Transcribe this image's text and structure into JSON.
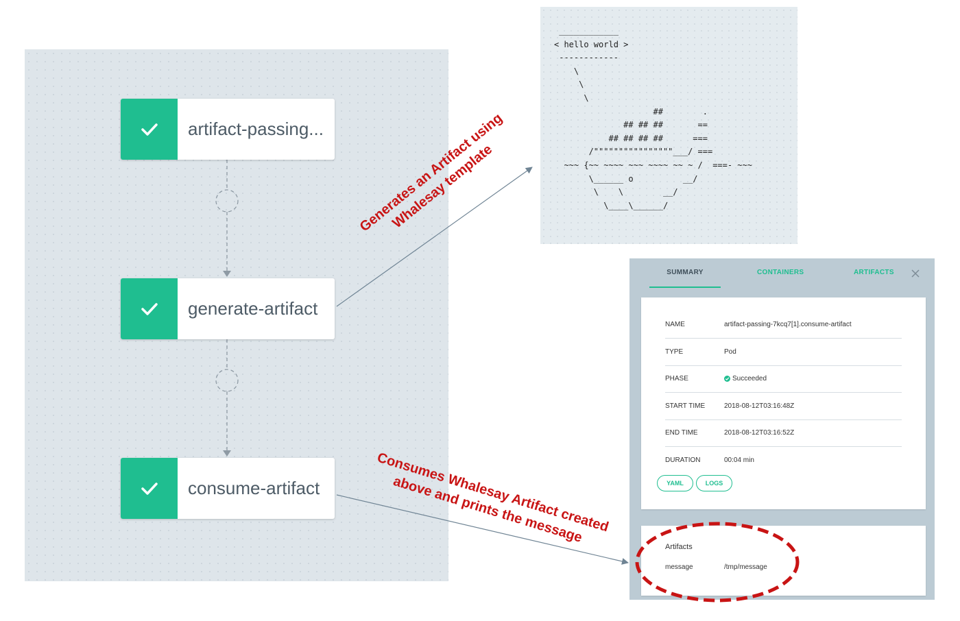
{
  "graph": {
    "nodes": [
      {
        "label": "artifact-passing...",
        "status": "succeeded"
      },
      {
        "label": "generate-artifact",
        "status": "succeeded"
      },
      {
        "label": "consume-artifact",
        "status": "succeeded"
      }
    ]
  },
  "whalesay_output": " ____________\n< hello world >\n ------------\n    \\\n     \\\n      \\\n                    ##        .\n              ## ## ##       ==\n           ## ## ## ##      ===\n       /\"\"\"\"\"\"\"\"\"\"\"\"\"\"\"\"___/ ===\n  ~~~ {~~ ~~~~ ~~~ ~~~~ ~~ ~ /  ===- ~~~\n       \\______ o          __/\n        \\    \\        __/\n          \\____\\______/",
  "annotations": {
    "generates_line1": "Generates an Artifact using",
    "generates_line2": "Whalesay template",
    "consumes_line1": "Consumes Whalesay Artifact created",
    "consumes_line2": "above and prints the message"
  },
  "panel": {
    "tabs": [
      "SUMMARY",
      "CONTAINERS",
      "ARTIFACTS"
    ],
    "active_tab": "SUMMARY",
    "summary": {
      "name_label": "NAME",
      "name_value": "artifact-passing-7kcq7[1].consume-artifact",
      "type_label": "TYPE",
      "type_value": "Pod",
      "phase_label": "PHASE",
      "phase_value": "Succeeded",
      "start_label": "START TIME",
      "start_value": "2018-08-12T03:16:48Z",
      "end_label": "END TIME",
      "end_value": "2018-08-12T03:16:52Z",
      "duration_label": "DURATION",
      "duration_value": "00:04 min"
    },
    "buttons": {
      "yaml": "YAML",
      "logs": "LOGS"
    },
    "artifacts": {
      "title": "Artifacts",
      "name": "message",
      "path": "/tmp/message"
    }
  },
  "colors": {
    "success": "#1fbe90",
    "annotation_red": "#c81414",
    "graph_bg": "#dee5ea",
    "panel_bg": "#bccbd4"
  },
  "icons": [
    "check-icon",
    "close-icon",
    "check-circle-icon"
  ]
}
